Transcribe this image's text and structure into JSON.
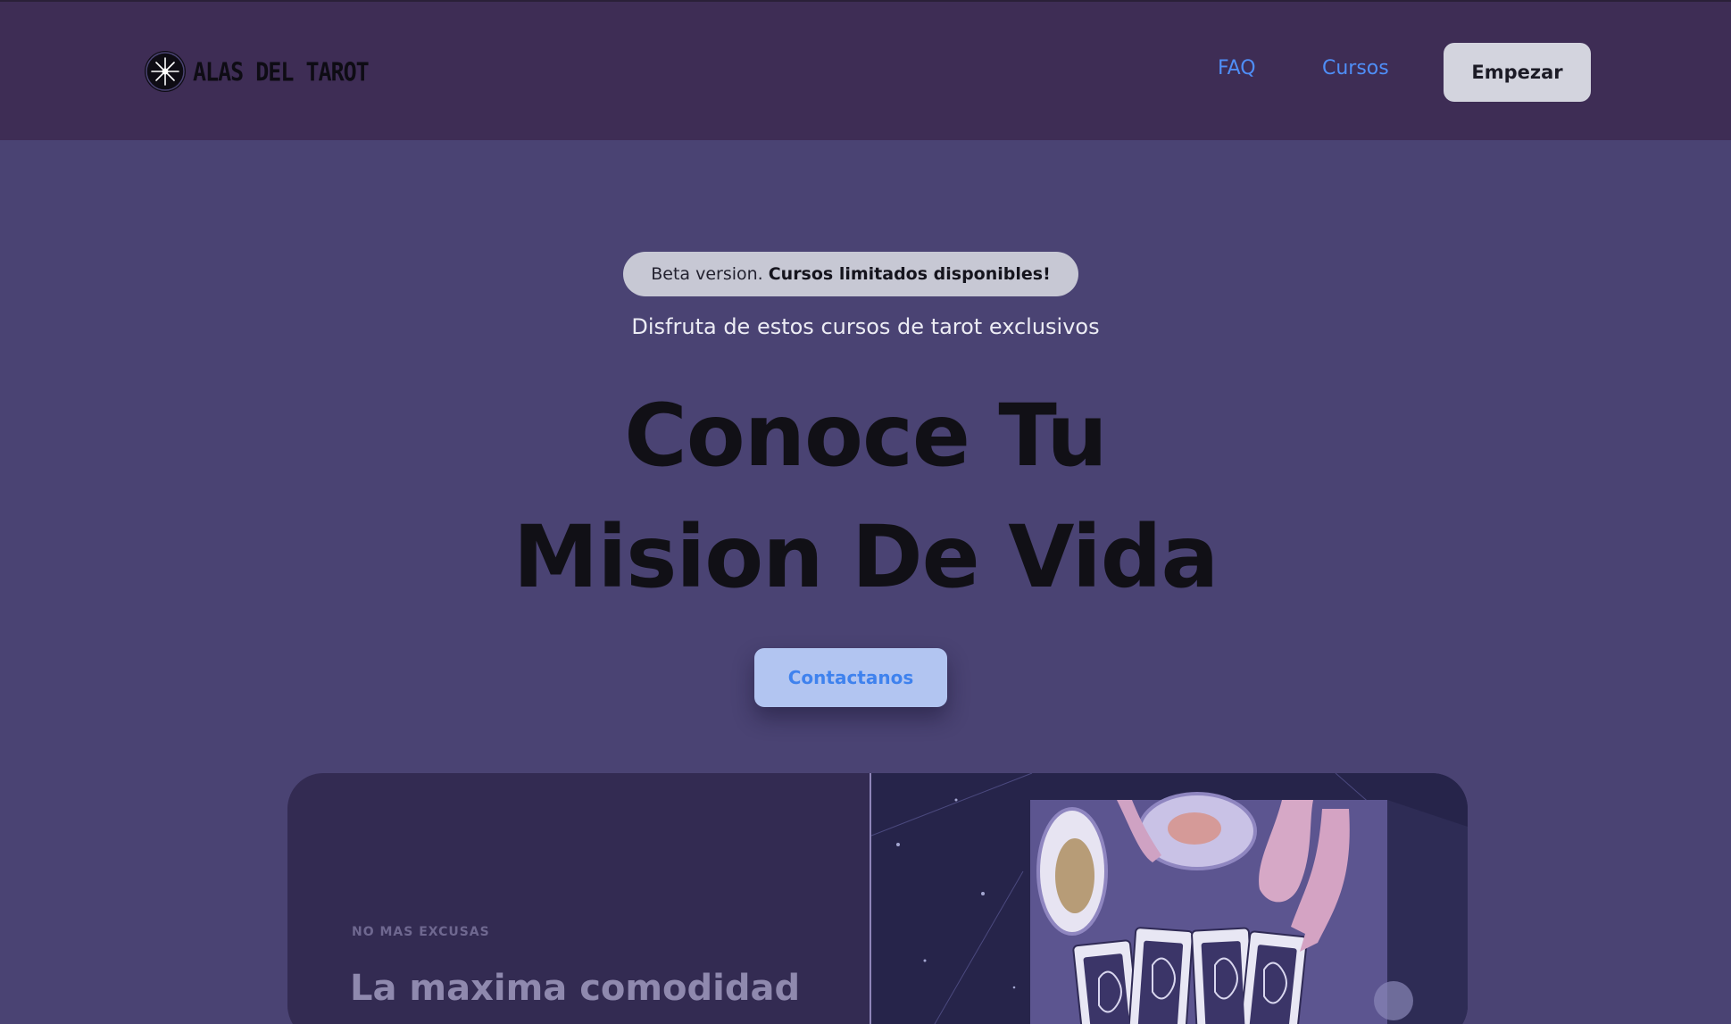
{
  "header": {
    "logo_text": "ALAS DEL TAROT",
    "logo_icon": "star-burst-icon",
    "nav": {
      "faq_label": "FAQ",
      "cursos_label": "Cursos"
    },
    "cta_label": "Empezar"
  },
  "hero": {
    "badge_prefix": "Beta version.",
    "badge_strong": "Cursos limitados disponibles!",
    "subtitle": "Disfruta de estos cursos de tarot exclusivos",
    "title_line1": "Conoce Tu",
    "title_line2": "Mision De Vida",
    "contact_label": "Contactanos"
  },
  "feature_card": {
    "eyebrow": "NO MAS EXCUSAS",
    "heading": "La maxima comodidad",
    "image_icon": "tarot-cards-illustration"
  },
  "colors": {
    "page_bg": "#4a4373",
    "header_bg": "#3e2d55",
    "link": "#4f8ef7",
    "card_left_bg": "#332b52",
    "card_right_bg": "#26244a"
  }
}
